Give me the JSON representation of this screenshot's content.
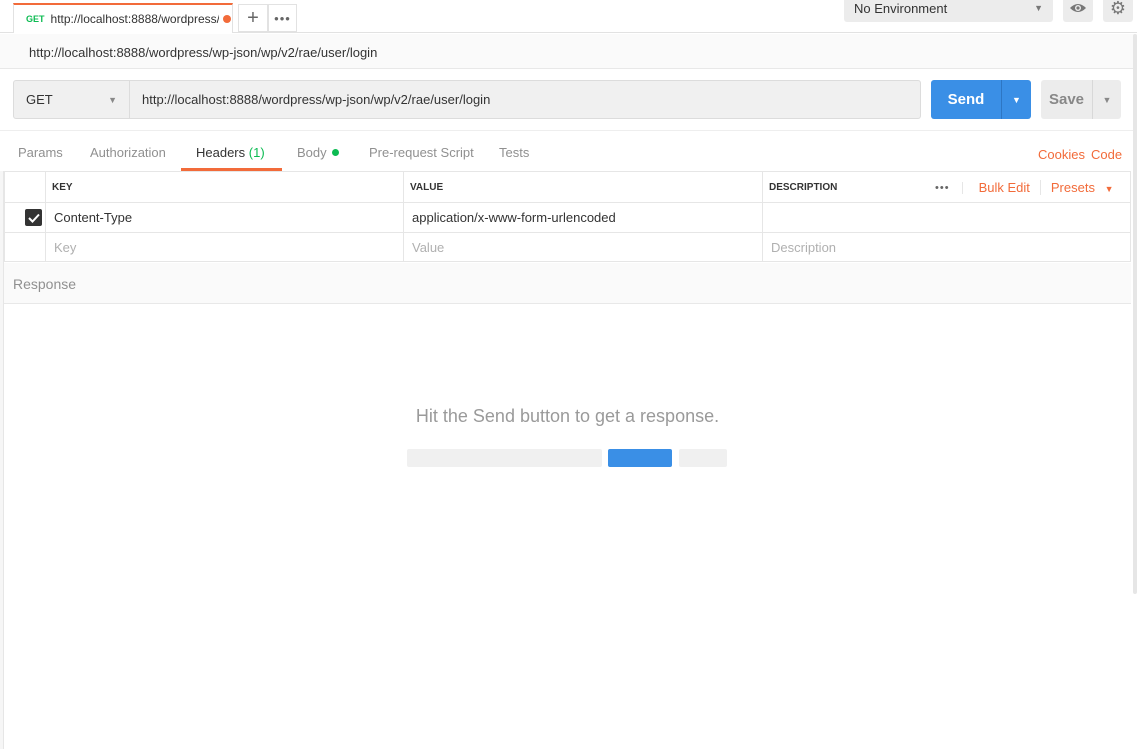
{
  "tab": {
    "method": "GET",
    "title": "http://localhost:8888/wordpress/wp-json/wp/v2/rae/user/login",
    "add_label": "+",
    "more_label": "•••"
  },
  "environment": {
    "selected": "No Environment"
  },
  "request": {
    "name": "http://localhost:8888/wordpress/wp-json/wp/v2/rae/user/login",
    "method": "GET",
    "url": "http://localhost:8888/wordpress/wp-json/wp/v2/rae/user/login",
    "send_label": "Send",
    "save_label": "Save"
  },
  "request_tabs": {
    "params": "Params",
    "authorization": "Authorization",
    "headers": "Headers",
    "headers_count": "(1)",
    "body": "Body",
    "prerequest": "Pre-request Script",
    "tests": "Tests",
    "cookies": "Cookies",
    "code": "Code"
  },
  "headers_table": {
    "columns": [
      "KEY",
      "VALUE",
      "DESCRIPTION"
    ],
    "more_label": "•••",
    "bulk_edit": "Bulk Edit",
    "presets": "Presets",
    "rows": [
      {
        "enabled": true,
        "key": "Content-Type",
        "value": "application/x-www-form-urlencoded",
        "description": ""
      }
    ],
    "placeholders": {
      "key": "Key",
      "value": "Value",
      "description": "Description"
    }
  },
  "response": {
    "label": "Response",
    "empty_message": "Hit the Send button to get a response."
  },
  "colors": {
    "accent_orange": "#f26b3a",
    "send_blue": "#3a8fe6",
    "get_green": "#0cbb52"
  },
  "icons": [
    "chevron-down-icon",
    "eye-icon",
    "gear-icon",
    "checkmark-icon",
    "more-icon",
    "plus-icon"
  ]
}
